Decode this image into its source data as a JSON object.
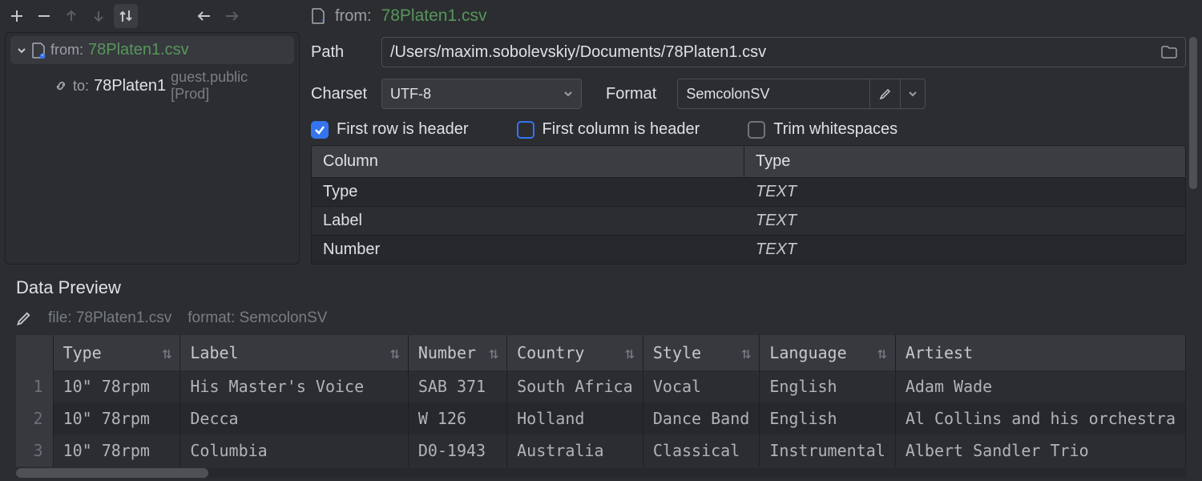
{
  "toolbar": {
    "add_tip": "Add",
    "remove_tip": "Remove",
    "up_tip": "Move Up",
    "down_tip": "Move Down",
    "swap_tip": "Swap",
    "back_tip": "Back",
    "fwd_tip": "Forward"
  },
  "tree": {
    "from_label": "from:",
    "from_file": "78Platen1.csv",
    "to_label": "to:",
    "to_target": "78Platen1",
    "to_suffix": "guest.public [Prod]"
  },
  "header": {
    "from_label": "from:",
    "from_file": "78Platen1.csv"
  },
  "form": {
    "path_label": "Path",
    "path_value": "/Users/maxim.sobolevskiy/Documents/78Platen1.csv",
    "charset_label": "Charset",
    "charset_value": "UTF-8",
    "format_label": "Format",
    "format_value": "SemcolonSV"
  },
  "checks": {
    "first_row_header": {
      "label": "First row is header",
      "checked": true
    },
    "first_col_header": {
      "label": "First column is header",
      "checked": false
    },
    "trim_whitespace": {
      "label": "Trim whitespaces",
      "checked": false
    }
  },
  "cols_grid": {
    "head_column": "Column",
    "head_type": "Type",
    "rows": [
      {
        "name": "Type",
        "type": "TEXT"
      },
      {
        "name": "Label",
        "type": "TEXT"
      },
      {
        "name": "Number",
        "type": "TEXT"
      }
    ]
  },
  "preview": {
    "title": "Data Preview",
    "file_prefix": "file:",
    "file_value": "78Platen1.csv",
    "format_prefix": "format:",
    "format_value": "SemcolonSV",
    "columns": [
      "Type",
      "Label",
      "Number",
      "Country",
      "Style",
      "Language",
      "Artiest"
    ],
    "rows": [
      {
        "n": "1",
        "cells": [
          "10\" 78rpm",
          "His Master's Voice",
          "SAB 371",
          "South Africa",
          "Vocal",
          "English",
          "Adam Wade"
        ]
      },
      {
        "n": "2",
        "cells": [
          "10\" 78rpm",
          "Decca",
          "W 126",
          "Holland",
          "Dance Band",
          "English",
          "Al Collins and his orchestra"
        ]
      },
      {
        "n": "3",
        "cells": [
          "10\" 78rpm",
          "Columbia",
          "D0-1943",
          "Australia",
          "Classical",
          "Instrumental",
          "Albert Sandler Trio"
        ]
      }
    ]
  }
}
